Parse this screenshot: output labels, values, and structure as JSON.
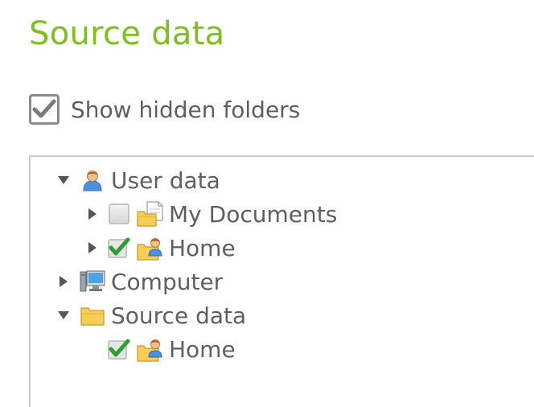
{
  "page_title": "Source data",
  "hidden_folders": {
    "label": "Show hidden folders",
    "checked": true
  },
  "tree": {
    "nodes": [
      {
        "label": "User data",
        "level": 0,
        "expander": "expanded",
        "icon": "user-icon",
        "checkbox": null
      },
      {
        "label": "My Documents",
        "level": 1,
        "expander": "collapsed",
        "icon": "documents-folder-icon",
        "checkbox": "unchecked"
      },
      {
        "label": "Home",
        "level": 1,
        "expander": "collapsed",
        "icon": "home-folder-icon",
        "checkbox": "checked"
      },
      {
        "label": "Computer",
        "level": 0,
        "expander": "collapsed",
        "icon": "computer-icon",
        "checkbox": null
      },
      {
        "label": "Source data",
        "level": 0,
        "expander": "expanded",
        "icon": "folder-icon",
        "checkbox": null
      },
      {
        "label": "Home",
        "level": 1,
        "expander": "none",
        "icon": "home-folder-icon",
        "checkbox": "checked"
      }
    ]
  },
  "colors": {
    "title_green": "#7cc11a",
    "text_gray": "#5f5f5f",
    "check_green": "#2e9e2e",
    "folder_yellow": "#f5c94a",
    "panel_border": "#cccccc"
  }
}
